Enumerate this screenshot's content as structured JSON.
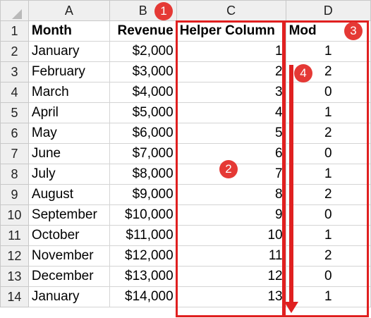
{
  "columns": [
    "A",
    "B",
    "C",
    "D"
  ],
  "row_numbers": [
    "1",
    "2",
    "3",
    "4",
    "5",
    "6",
    "7",
    "8",
    "9",
    "10",
    "11",
    "12",
    "13",
    "14"
  ],
  "headers": {
    "month": "Month",
    "revenue": "Revenue",
    "helper": "Helper Column",
    "mod": "Mod"
  },
  "rows": [
    {
      "month": "January",
      "revenue": "$2,000",
      "helper": "1",
      "mod": "1"
    },
    {
      "month": "February",
      "revenue": "$3,000",
      "helper": "2",
      "mod": "2"
    },
    {
      "month": "March",
      "revenue": "$4,000",
      "helper": "3",
      "mod": "0"
    },
    {
      "month": "April",
      "revenue": "$5,000",
      "helper": "4",
      "mod": "1"
    },
    {
      "month": "May",
      "revenue": "$6,000",
      "helper": "5",
      "mod": "2"
    },
    {
      "month": "June",
      "revenue": "$7,000",
      "helper": "6",
      "mod": "0"
    },
    {
      "month": "July",
      "revenue": "$8,000",
      "helper": "7",
      "mod": "1"
    },
    {
      "month": "August",
      "revenue": "$9,000",
      "helper": "8",
      "mod": "2"
    },
    {
      "month": "September",
      "revenue": "$10,000",
      "helper": "9",
      "mod": "0"
    },
    {
      "month": "October",
      "revenue": "$11,000",
      "helper": "10",
      "mod": "1"
    },
    {
      "month": "November",
      "revenue": "$12,000",
      "helper": "11",
      "mod": "2"
    },
    {
      "month": "December",
      "revenue": "$13,000",
      "helper": "12",
      "mod": "0"
    },
    {
      "month": "January",
      "revenue": "$14,000",
      "helper": "13",
      "mod": "1"
    }
  ],
  "annotations": {
    "one": "1",
    "two": "2",
    "three": "3",
    "four": "4"
  },
  "colors": {
    "annotation": "#e02020",
    "badge": "#e53935"
  }
}
